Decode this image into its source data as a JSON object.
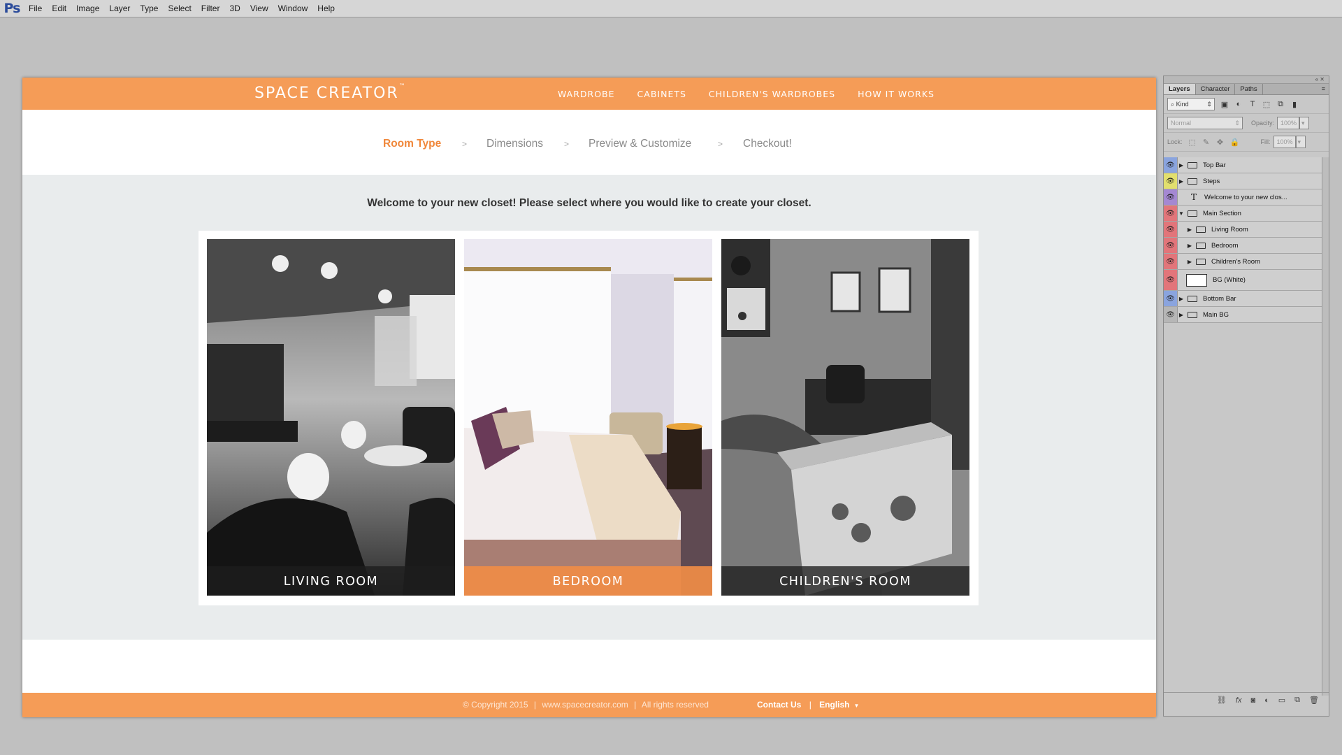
{
  "app": {
    "logo": "Ps",
    "menu": [
      "File",
      "Edit",
      "Image",
      "Layer",
      "Type",
      "Select",
      "Filter",
      "3D",
      "View",
      "Window",
      "Help"
    ]
  },
  "site": {
    "brand": "SPACE CREATOR",
    "trademark": "™",
    "nav": [
      "WARDROBE",
      "CABINETS",
      "CHILDREN'S WARDROBES",
      "HOW IT WORKS"
    ],
    "steps": [
      "Room Type",
      "Dimensions",
      "Preview & Customize",
      "Checkout!"
    ],
    "step_separator": ">",
    "active_step": "Room Type",
    "welcome": "Welcome to your new closet! Please select where you would like to create your closet.",
    "rooms": [
      "LIVING ROOM",
      "BEDROOM",
      "CHILDREN'S ROOM"
    ],
    "footer": {
      "copyright": "© Copyright 2015",
      "url": "www.spacecreator.com",
      "rights": "All rights reserved",
      "contact": "Contact Us",
      "language": "English",
      "divider": "|"
    },
    "colors": {
      "accent": "#f59c57",
      "active_step": "#f0873a",
      "main_bg": "#e9eced"
    }
  },
  "panel": {
    "tabs": [
      "Layers",
      "Character",
      "Paths"
    ],
    "filter_kind": "Kind",
    "blend_mode": "Normal",
    "opacity_label": "Opacity:",
    "opacity": "100%",
    "lock_label": "Lock:",
    "fill_label": "Fill:",
    "fill": "100%",
    "layers": [
      {
        "name": "Top Bar",
        "color": "#8aa4de"
      },
      {
        "name": "Steps",
        "color": "#e2df6e"
      },
      {
        "name": "Welcome to your new clos...",
        "color": "#a488d2"
      },
      {
        "name": "Main Section",
        "color": "#e2757a"
      },
      {
        "name": "Living Room",
        "color": "#e2757a"
      },
      {
        "name": "Bedroom",
        "color": "#e2757a"
      },
      {
        "name": "Children's Room",
        "color": "#e2757a"
      },
      {
        "name": "BG (White)",
        "color": "#e2757a"
      },
      {
        "name": "Bottom Bar",
        "color": "#8aa4de"
      },
      {
        "name": "Main BG",
        "color": "#b6b6b6"
      }
    ]
  }
}
